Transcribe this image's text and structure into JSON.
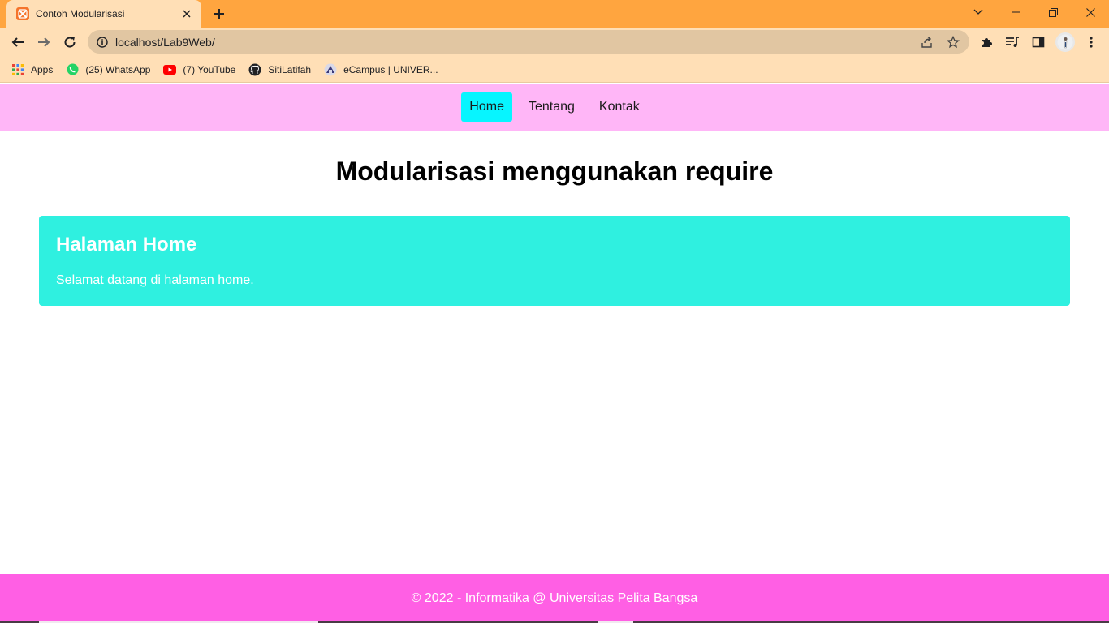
{
  "browser": {
    "tab": {
      "title": "Contoh Modularisasi"
    },
    "address": {
      "url": "localhost/Lab9Web/"
    },
    "bookmarks": [
      {
        "label": "Apps",
        "icon": "apps-grid-icon"
      },
      {
        "label": "(25) WhatsApp",
        "icon": "whatsapp-icon"
      },
      {
        "label": "(7) YouTube",
        "icon": "youtube-icon"
      },
      {
        "label": "SitiLatifah",
        "icon": "github-icon"
      },
      {
        "label": "eCampus | UNIVER...",
        "icon": "ecampus-icon"
      }
    ],
    "colors": {
      "tabstrip": "#ffa53f",
      "toolbar": "#ffdfb6",
      "omnibox": "#e1c6a2"
    }
  },
  "site": {
    "nav": {
      "items": [
        {
          "label": "Home",
          "active": true
        },
        {
          "label": "Tentang",
          "active": false
        },
        {
          "label": "Kontak",
          "active": false
        }
      ]
    },
    "title": "Modularisasi menggunakan require",
    "card": {
      "title": "Halaman Home",
      "text": "Selamat datang di halaman home."
    },
    "footer": {
      "text": "© 2022 - Informatika @ Universitas Pelita Bangsa"
    },
    "colors": {
      "nav_bg": "#ffb6f7",
      "nav_active": "#07f5ff",
      "card_bg": "#2ff0e0",
      "footer_bg": "#ff5fe4"
    }
  }
}
